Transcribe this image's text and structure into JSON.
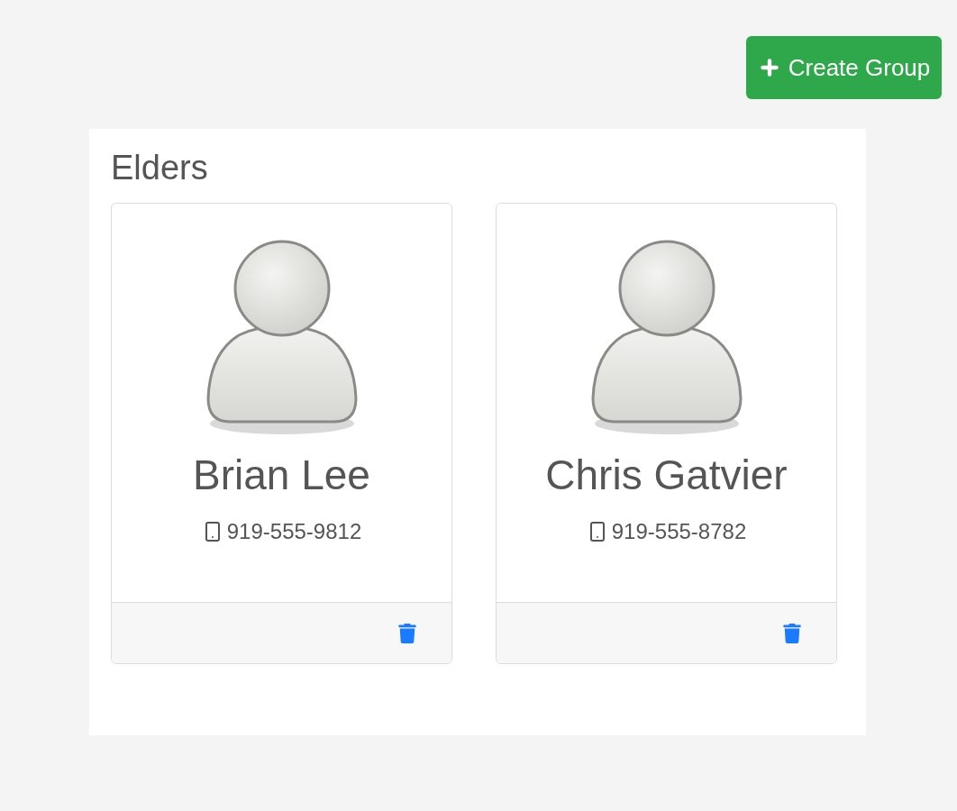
{
  "create_button": {
    "label": "Create Group"
  },
  "group": {
    "title": "Elders",
    "members": [
      {
        "name": "Brian Lee",
        "phone": "919-555-9812"
      },
      {
        "name": "Chris Gatvier",
        "phone": "919-555-8782"
      }
    ]
  }
}
